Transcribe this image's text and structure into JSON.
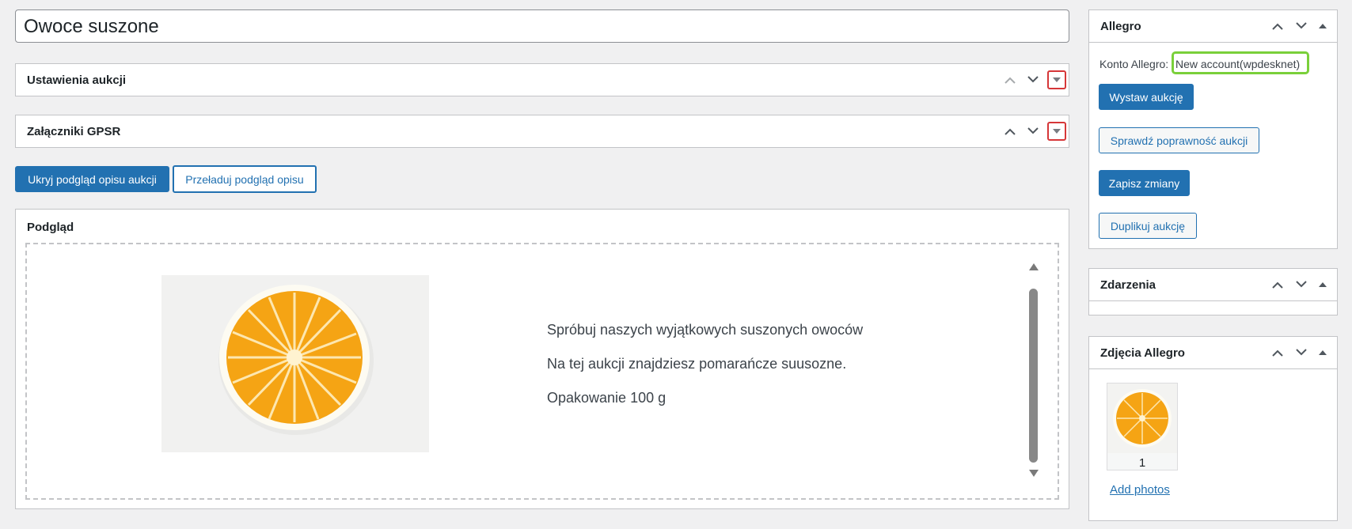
{
  "title_input": {
    "value": "Owoce suszone"
  },
  "panels": {
    "auction_settings": {
      "title": "Ustawienia aukcji"
    },
    "gpsr": {
      "title": "Załączniki GPSR"
    },
    "preview": {
      "title": "Podgląd"
    }
  },
  "preview_buttons": {
    "hide_label": "Ukryj podgląd opisu aukcji",
    "reload_label": "Przeładuj podgląd opisu"
  },
  "preview_content": {
    "lines": [
      "Spróbuj naszych wyjątkowych suszonych owoców",
      "Na tej aukcji znajdziesz pomarańcze suusozne.",
      "Opakowanie 100 g"
    ]
  },
  "sidebar": {
    "allegro": {
      "title": "Allegro",
      "account_label": "Konto Allegro:",
      "account_value": "New account(wpdesknet)",
      "buttons": {
        "publish": "Wystaw aukcję",
        "validate": "Sprawdź poprawność aukcji",
        "save": "Zapisz zmiany",
        "duplicate": "Duplikuj aukcję"
      }
    },
    "events": {
      "title": "Zdarzenia"
    },
    "photos": {
      "title": "Zdjęcia Allegro",
      "photo_number": "1",
      "add_link": "Add photos"
    }
  },
  "colors": {
    "primary": "#2271b1",
    "highlight_green": "#7ad03a",
    "highlight_red": "#d63638",
    "orange": "#f7a51b"
  }
}
